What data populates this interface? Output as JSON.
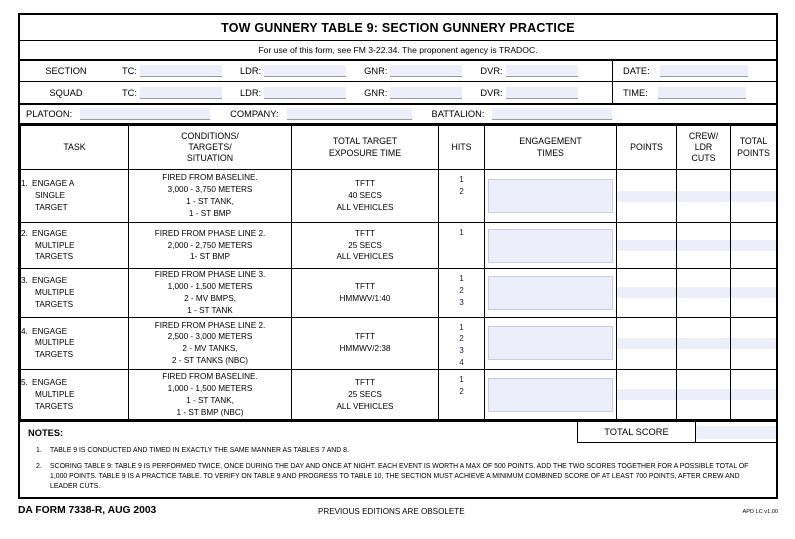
{
  "form": {
    "title": "TOW GUNNERY TABLE 9: SECTION GUNNERY PRACTICE",
    "subtitle": "For use of this form, see FM 3-22.34. The proponent agency is TRADOC."
  },
  "identification": {
    "row1_label": "SECTION",
    "row2_label": "SQUAD",
    "crew_labels": [
      "TC:",
      "LDR:",
      "GNR:",
      "DVR:"
    ],
    "date_label": "DATE:",
    "time_label": "TIME:",
    "platoon_label": "PLATOON:",
    "company_label": "COMPANY:",
    "battalion_label": "BATTALION:"
  },
  "table": {
    "headers": [
      "TASK",
      "CONDITIONS/\nTARGETS/\nSITUATION",
      "TOTAL TARGET\nEXPOSURE TIME",
      "HITS",
      "ENGAGEMENT\nTIMES",
      "POINTS",
      "CREW/\nLDR\nCUTS",
      "TOTAL\nPOINTS"
    ],
    "header_lines": {
      "task": [
        "TASK"
      ],
      "conditions": [
        "CONDITIONS/",
        "TARGETS/",
        "SITUATION"
      ],
      "exposure": [
        "TOTAL TARGET",
        "EXPOSURE TIME"
      ],
      "hits": [
        "HITS"
      ],
      "engagement": [
        "ENGAGEMENT",
        "TIMES"
      ],
      "points": [
        "POINTS"
      ],
      "cuts": [
        "CREW/",
        "LDR",
        "CUTS"
      ],
      "total_points": [
        "TOTAL",
        "POINTS"
      ]
    },
    "rows": [
      {
        "num": "1.",
        "task_lines": [
          "ENGAGE A",
          "SINGLE",
          "TARGET"
        ],
        "conditions_lines": [
          "FIRED FROM BASELINE.",
          "3,000 - 3,750 METERS",
          "1 - ST TANK,",
          "1 - ST BMP"
        ],
        "exposure_lines": [
          "TFTT",
          "40 SECS",
          "ALL VEHICLES"
        ],
        "hits": [
          "1",
          "2"
        ]
      },
      {
        "num": "2.",
        "task_lines": [
          "ENGAGE",
          "MULTIPLE",
          "TARGETS"
        ],
        "conditions_lines": [
          "FIRED FROM PHASE LINE 2.",
          "2,000 - 2,750 METERS",
          "1- ST BMP"
        ],
        "exposure_lines": [
          "TFTT",
          "25 SECS",
          "ALL VEHICLES"
        ],
        "hits": [
          "1"
        ]
      },
      {
        "num": "3.",
        "task_lines": [
          "ENGAGE",
          "MULTIPLE",
          "TARGETS"
        ],
        "conditions_lines": [
          "FIRED FROM PHASE LINE 3.",
          "1,000 - 1,500 METERS",
          "2 - MV BMPS,",
          "1 - ST TANK"
        ],
        "exposure_lines": [
          "TFTT",
          "HMMWV/1:40"
        ],
        "hits": [
          "1",
          "2",
          "3"
        ]
      },
      {
        "num": "4.",
        "task_lines": [
          "ENGAGE",
          "MULTIPLE",
          "TARGETS"
        ],
        "conditions_lines": [
          "FIRED FROM PHASE LINE 2.",
          "2,500 - 3,000 METERS",
          "2 - MV TANKS,",
          "2 - ST TANKS (NBC)"
        ],
        "exposure_lines": [
          "TFTT",
          "HMMWV/2:38"
        ],
        "hits": [
          "1",
          "2",
          "3",
          "4"
        ]
      },
      {
        "num": "5.",
        "task_lines": [
          "ENGAGE",
          "MULTIPLE",
          "TARGETS"
        ],
        "conditions_lines": [
          "FIRED FROM BASELINE.",
          "1,000 - 1,500 METERS",
          "1 - ST TANK,",
          "1 - ST BMP (NBC)"
        ],
        "exposure_lines": [
          "TFTT",
          "25 SECS",
          "ALL VEHICLES"
        ],
        "hits": [
          "1",
          "2"
        ]
      }
    ]
  },
  "total_score": {
    "label": "TOTAL SCORE"
  },
  "notes": {
    "heading": "NOTES:",
    "items": [
      {
        "num": "1.",
        "text": "TABLE 9 IS CONDUCTED AND TIMED IN EXACTLY THE SAME MANNER AS TABLES 7 AND 8."
      },
      {
        "num": "2.",
        "text": "SCORING TABLE 9: TABLE 9 IS PERFORMED TWICE, ONCE DURING THE DAY AND ONCE AT NIGHT. EACH EVENT IS WORTH A MAX OF 500 POINTS.  ADD THE TWO SCORES TOGETHER FOR A POSSIBLE TOTAL OF 1,000 POINTS. TABLE 9 IS A PRACTICE TABLE. TO VERIFY ON TABLE 9 AND PROGRESS TO TABLE 10, THE SECTION MUST ACHIEVE A MINIMUM COMBINED SCORE  OF AT LEAST 700 POINTS, AFTER CREW AND LEADER CUTS."
      }
    ]
  },
  "footer": {
    "form_id": "DA FORM 7338-R, AUG 2003",
    "obsolete_note": "PREVIOUS EDITIONS ARE OBSOLETE",
    "version": "APD LC v1.00"
  },
  "colors": {
    "field_fill": "#eceffa",
    "border": "#000000"
  }
}
